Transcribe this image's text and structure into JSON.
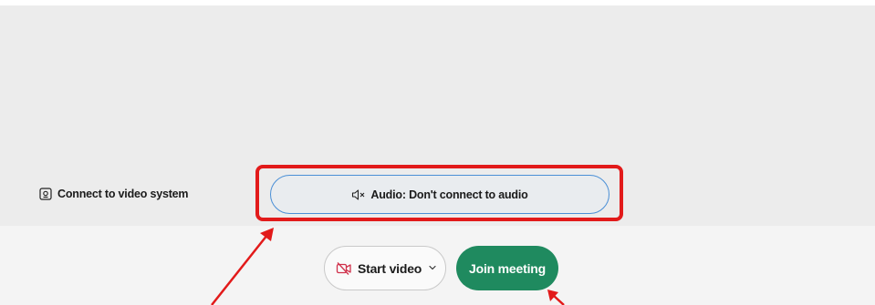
{
  "connect_video": {
    "label": "Connect to video system",
    "icon": "video-system-icon"
  },
  "audio": {
    "label": "Audio: Don't connect to audio",
    "icon": "speaker-muted-icon"
  },
  "video_button": {
    "label": "Start video",
    "icon": "video-off-icon",
    "dropdown_icon": "chevron-down-icon"
  },
  "join_button": {
    "label": "Join meeting"
  },
  "colors": {
    "preview_bg": "#ececec",
    "bottom_bar_bg": "#f4f4f4",
    "join_green": "#1f8a5f",
    "annotation_red": "#e21a1a",
    "focus_blue": "#4a8fd6",
    "video_off_red": "#d0314b"
  }
}
